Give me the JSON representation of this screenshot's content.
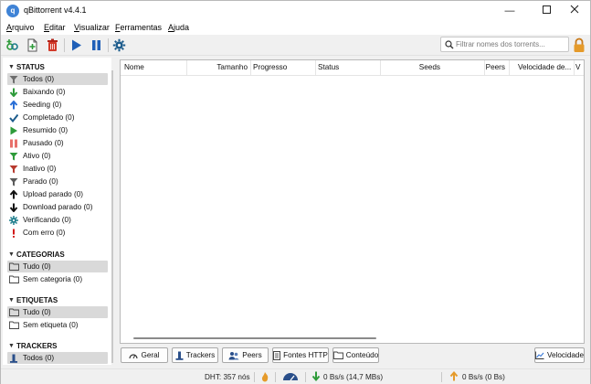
{
  "window": {
    "title": "qBittorrent v4.4.1",
    "app_icon_letter": "q"
  },
  "menu": [
    "Arquivo",
    "Editar",
    "Visualizar",
    "Ferramentas",
    "Ajuda"
  ],
  "search": {
    "placeholder": "Filtrar nomes dos torrents..."
  },
  "sidebar": {
    "status": {
      "title": "STATUS",
      "items": [
        {
          "label": "Todos (0)",
          "icon": "filter-icon"
        },
        {
          "label": "Baixando (0)",
          "icon": "arrow-down-icon"
        },
        {
          "label": "Seeding (0)",
          "icon": "arrow-up-icon"
        },
        {
          "label": "Completado (0)",
          "icon": "checkmark-icon"
        },
        {
          "label": "Resumido (0)",
          "icon": "play-icon"
        },
        {
          "label": "Pausado (0)",
          "icon": "pause-icon"
        },
        {
          "label": "Ativo (0)",
          "icon": "filter-icon"
        },
        {
          "label": "Inativo (0)",
          "icon": "filter-icon"
        },
        {
          "label": "Parado (0)",
          "icon": "filter-icon"
        },
        {
          "label": "Upload parado (0)",
          "icon": "arrow-up-icon"
        },
        {
          "label": "Download parado (0)",
          "icon": "arrow-down-icon"
        },
        {
          "label": "Verificando (0)",
          "icon": "gear-icon"
        },
        {
          "label": "Com erro (0)",
          "icon": "exclamation-icon"
        }
      ]
    },
    "categories": {
      "title": "CATEGORIAS",
      "items": [
        {
          "label": "Tudo (0)",
          "icon": "folder-icon"
        },
        {
          "label": "Sem categoria (0)",
          "icon": "folder-icon"
        }
      ]
    },
    "tags": {
      "title": "ETIQUETAS",
      "items": [
        {
          "label": "Tudo (0)",
          "icon": "folder-icon"
        },
        {
          "label": "Sem etiqueta (0)",
          "icon": "folder-icon"
        }
      ]
    },
    "trackers": {
      "title": "TRACKERS",
      "items": [
        {
          "label": "Todos (0)",
          "icon": "tracker-icon"
        }
      ]
    }
  },
  "table": {
    "columns": [
      "Nome",
      "Tamanho",
      "Progresso",
      "Status",
      "Seeds",
      "Peers",
      "Velocidade de...",
      "V"
    ],
    "rows": []
  },
  "tabs": [
    "Geral",
    "Trackers",
    "Peers",
    "Fontes HTTP",
    "Conteúdo"
  ],
  "speed_button": "Velocidade",
  "statusbar": {
    "dht": "DHT: 357 nós",
    "download": "0 Bs/s (14,7 MBs)",
    "upload": "0 Bs/s (0 Bs)"
  },
  "colors": {
    "green": "#2e9b3a",
    "blue": "#2a6fd6",
    "red": "#d23a2a",
    "gear": "#1d7d8c",
    "selection": "#d9d9d9"
  }
}
